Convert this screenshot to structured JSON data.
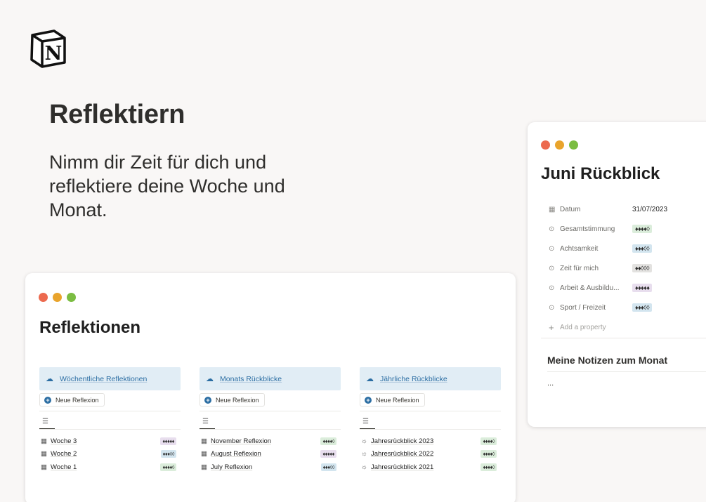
{
  "hero": {
    "title": "Reflektiern",
    "subtitle": "Nimm dir Zeit für dich und reflektiere deine Woche und Monat."
  },
  "left_card": {
    "title": "Reflektionen",
    "columns": [
      {
        "header": "Wöchentliche Reflektionen",
        "new_button": "Neue Reflexion",
        "rows": [
          {
            "icon": "calendar-icon",
            "label": "Woche 3",
            "rating": "♦♦♦♦♦",
            "color": "purple"
          },
          {
            "icon": "calendar-icon",
            "label": "Woche 2",
            "rating": "♦♦♦◊◊",
            "color": "blue"
          },
          {
            "icon": "calendar-icon",
            "label": "Woche 1",
            "rating": "♦♦♦♦◊",
            "color": "green"
          }
        ]
      },
      {
        "header": "Monats Rückblicke",
        "new_button": "Neue Reflexion",
        "rows": [
          {
            "icon": "calendar-icon",
            "label": "November Reflexion",
            "rating": "♦♦♦♦◊",
            "color": "green"
          },
          {
            "icon": "calendar-icon",
            "label": "August Reflexion",
            "rating": "♦♦♦♦♦",
            "color": "purple"
          },
          {
            "icon": "calendar-icon",
            "label": "July Reflexion",
            "rating": "♦♦♦◊◊",
            "color": "blue"
          }
        ]
      },
      {
        "header": "Jährliche Rückblicke",
        "new_button": "Neue Reflexion",
        "rows": [
          {
            "icon": "sun-icon",
            "label": "Jahresrückblick 2023",
            "rating": "♦♦♦♦◊",
            "color": "green"
          },
          {
            "icon": "sun-icon",
            "label": "Jahresrückblick 2022",
            "rating": "♦♦♦♦◊",
            "color": "green"
          },
          {
            "icon": "sun-icon",
            "label": "Jahresrückblick 2021",
            "rating": "♦♦♦♦◊",
            "color": "green"
          }
        ]
      }
    ]
  },
  "right_card": {
    "title": "Juni Rückblick",
    "properties": [
      {
        "icon": "calendar-icon",
        "name": "Datum",
        "value": "31/07/2023"
      },
      {
        "icon": "select-icon",
        "name": "Gesamtstimmung",
        "value": "♦♦♦♦◊",
        "color": "green"
      },
      {
        "icon": "select-icon",
        "name": "Achtsamkeit",
        "value": "♦♦♦◊◊",
        "color": "blue"
      },
      {
        "icon": "select-icon",
        "name": "Zeit für mich",
        "value": "♦♦◊◊◊",
        "color": "gray"
      },
      {
        "icon": "select-icon",
        "name": "Arbeit & Ausbildu...",
        "value": "♦♦♦♦♦",
        "color": "purple"
      },
      {
        "icon": "select-icon",
        "name": "Sport / Freizeit",
        "value": "♦♦♦◊◊",
        "color": "blue"
      }
    ],
    "add_property": "Add a property",
    "notes_title": "Meine Notizen zum Monat",
    "notes_body": "..."
  }
}
